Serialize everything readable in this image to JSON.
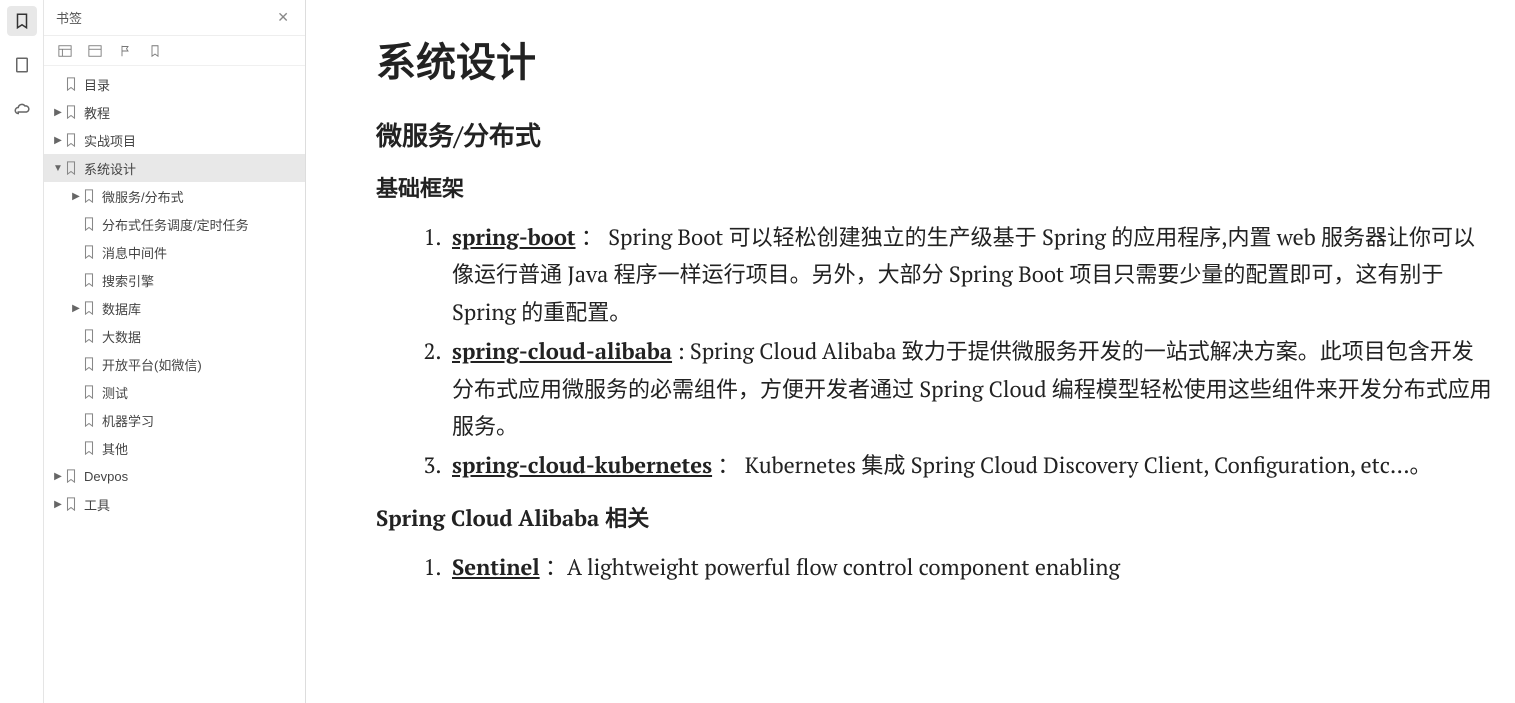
{
  "rail": {
    "icons": [
      "bookmark-icon",
      "page-icon",
      "cloud-icon"
    ]
  },
  "sidebar": {
    "title": "书签",
    "toolbar_icons": [
      "layout-icon",
      "collapse-icon",
      "flag-icon",
      "bookmark-outline-icon"
    ],
    "tree": [
      {
        "depth": 0,
        "twisty": "",
        "label": "目录"
      },
      {
        "depth": 0,
        "twisty": "▶",
        "label": "教程"
      },
      {
        "depth": 0,
        "twisty": "▶",
        "label": "实战项目"
      },
      {
        "depth": 0,
        "twisty": "▼",
        "label": "系统设计",
        "selected": true
      },
      {
        "depth": 1,
        "twisty": "▶",
        "label": "微服务/分布式"
      },
      {
        "depth": 1,
        "twisty": "",
        "label": "分布式任务调度/定时任务"
      },
      {
        "depth": 1,
        "twisty": "",
        "label": "消息中间件"
      },
      {
        "depth": 1,
        "twisty": "",
        "label": "搜索引擎"
      },
      {
        "depth": 1,
        "twisty": "▶",
        "label": "数据库"
      },
      {
        "depth": 1,
        "twisty": "",
        "label": "大数据"
      },
      {
        "depth": 1,
        "twisty": "",
        "label": "开放平台(如微信)"
      },
      {
        "depth": 1,
        "twisty": "",
        "label": "测试"
      },
      {
        "depth": 1,
        "twisty": "",
        "label": "机器学习"
      },
      {
        "depth": 1,
        "twisty": "",
        "label": "其他"
      },
      {
        "depth": 0,
        "twisty": "▶",
        "label": "Devpos"
      },
      {
        "depth": 0,
        "twisty": "▶",
        "label": "工具"
      }
    ]
  },
  "content": {
    "h1": "系统设计",
    "h2_a": "微服务/分布式",
    "h3_a": "基础框架",
    "list_a": [
      {
        "link": "spring-boot",
        "text": " ： Spring Boot 可以轻松创建独立的生产级基于 Spring 的应用程序,内置 web 服务器让你可以像运行普通 Java 程序一样运行项目。另外，大部分 Spring Boot 项目只需要少量的配置即可，这有别于 Spring 的重配置。"
      },
      {
        "link": "spring-cloud-alibaba",
        "text": " : Spring Cloud Alibaba 致力于提供微服务开发的一站式解决方案。此项目包含开发分布式应用微服务的必需组件，方便开发者通过 Spring Cloud 编程模型轻松使用这些组件来开发分布式应用服务。"
      },
      {
        "link": "spring-cloud-kubernetes",
        "text": " ： Kubernetes 集成 Spring Cloud Discovery Client, Configuration, etc...。"
      }
    ],
    "h3_b": "Spring Cloud Alibaba 相关",
    "list_b": [
      {
        "link": "Sentinel",
        "text": " ：A lightweight powerful flow control component enabling"
      }
    ]
  }
}
